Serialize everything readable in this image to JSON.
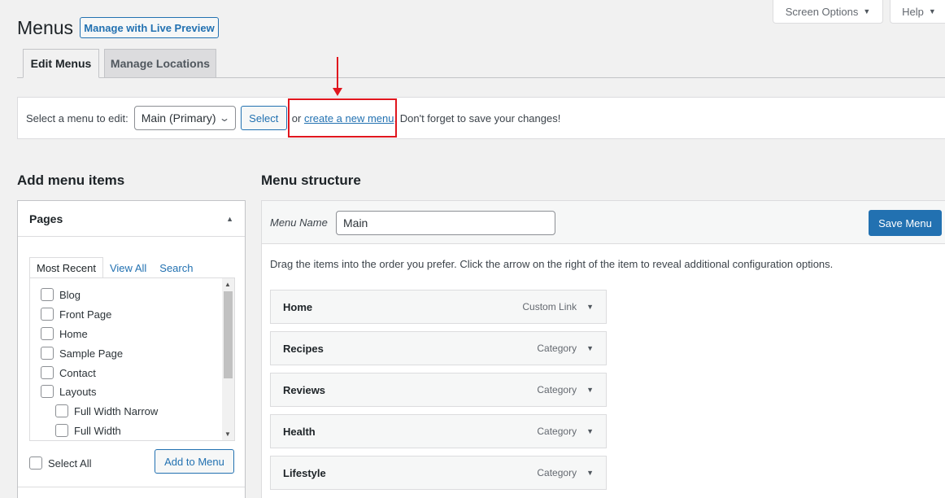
{
  "header": {
    "title": "Menus",
    "live_preview": "Manage with Live Preview",
    "screen_options": "Screen Options",
    "help": "Help"
  },
  "tabs": [
    {
      "label": "Edit Menus"
    },
    {
      "label": "Manage Locations"
    }
  ],
  "select_bar": {
    "label": "Select a menu to edit:",
    "selected_menu": "Main (Primary)",
    "select_button": "Select",
    "or_text": "or",
    "create_link": "create a new menu",
    "after_text": ". Don't forget to save your changes!"
  },
  "add_items": {
    "heading": "Add menu items",
    "pages_title": "Pages",
    "tabs": [
      "Most Recent",
      "View All",
      "Search"
    ],
    "items": [
      {
        "label": "Blog"
      },
      {
        "label": "Front Page"
      },
      {
        "label": "Home"
      },
      {
        "label": "Sample Page"
      },
      {
        "label": "Contact"
      },
      {
        "label": "Layouts"
      },
      {
        "label": "Full Width Narrow"
      },
      {
        "label": "Full Width"
      }
    ],
    "select_all": "Select All",
    "add_button": "Add to Menu"
  },
  "structure": {
    "heading": "Menu structure",
    "menu_name_label": "Menu Name",
    "menu_name_value": "Main",
    "save_button": "Save Menu",
    "instructions": "Drag the items into the order you prefer. Click the arrow on the right of the item to reveal additional configuration options.",
    "items": [
      {
        "title": "Home",
        "type": "Custom Link"
      },
      {
        "title": "Recipes",
        "type": "Category"
      },
      {
        "title": "Reviews",
        "type": "Category"
      },
      {
        "title": "Health",
        "type": "Category"
      },
      {
        "title": "Lifestyle",
        "type": "Category"
      }
    ]
  },
  "colors": {
    "accent": "#2271b1",
    "annotation": "#e0161e"
  },
  "icons": {
    "dropdown": "chevron-down-icon",
    "collapse": "triangle-up-icon",
    "item_toggle": "triangle-down-icon",
    "annotation_arrow": "arrow-down-icon"
  }
}
